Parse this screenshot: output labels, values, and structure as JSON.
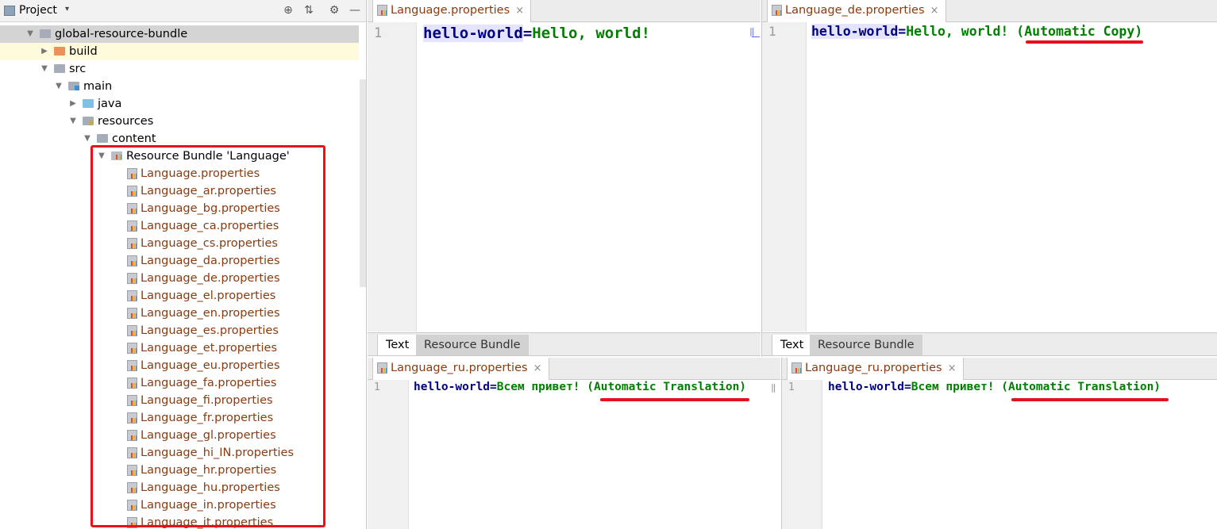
{
  "project_panel": {
    "title": "Project",
    "dropdown_glyph": "▾",
    "buttons": [
      "⊕",
      "⇅",
      "⚙",
      "—"
    ],
    "tree": [
      {
        "label": "global-resource-bundle",
        "icon": "folder-gray",
        "arrow": "▼"
      },
      {
        "label": "build",
        "icon": "folder-orange",
        "arrow": "▶"
      },
      {
        "label": "src",
        "icon": "folder-gray",
        "arrow": "▼"
      },
      {
        "label": "main",
        "icon": "folder-main",
        "arrow": "▼"
      },
      {
        "label": "java",
        "icon": "folder-blue",
        "arrow": "▶"
      },
      {
        "label": "resources",
        "icon": "folder-resources",
        "arrow": "▼"
      },
      {
        "label": "content",
        "icon": "folder-gray",
        "arrow": "▼"
      },
      {
        "label": "Resource Bundle 'Language'",
        "icon": "resource-bundle",
        "arrow": "▼"
      },
      {
        "label": "Language.properties",
        "icon": "properties-file"
      },
      {
        "label": "Language_ar.properties",
        "icon": "properties-file"
      },
      {
        "label": "Language_bg.properties",
        "icon": "properties-file"
      },
      {
        "label": "Language_ca.properties",
        "icon": "properties-file"
      },
      {
        "label": "Language_cs.properties",
        "icon": "properties-file"
      },
      {
        "label": "Language_da.properties",
        "icon": "properties-file"
      },
      {
        "label": "Language_de.properties",
        "icon": "properties-file"
      },
      {
        "label": "Language_el.properties",
        "icon": "properties-file"
      },
      {
        "label": "Language_en.properties",
        "icon": "properties-file"
      },
      {
        "label": "Language_es.properties",
        "icon": "properties-file"
      },
      {
        "label": "Language_et.properties",
        "icon": "properties-file"
      },
      {
        "label": "Language_eu.properties",
        "icon": "properties-file"
      },
      {
        "label": "Language_fa.properties",
        "icon": "properties-file"
      },
      {
        "label": "Language_fi.properties",
        "icon": "properties-file"
      },
      {
        "label": "Language_fr.properties",
        "icon": "properties-file"
      },
      {
        "label": "Language_gl.properties",
        "icon": "properties-file"
      },
      {
        "label": "Language_hi_IN.properties",
        "icon": "properties-file"
      },
      {
        "label": "Language_hr.properties",
        "icon": "properties-file"
      },
      {
        "label": "Language_hu.properties",
        "icon": "properties-file"
      },
      {
        "label": "Language_in.properties",
        "icon": "properties-file"
      },
      {
        "label": "Language_it.properties",
        "icon": "properties-file"
      }
    ]
  },
  "editors": {
    "top_left": {
      "tab": "Language.properties",
      "line": "1",
      "key": "hello-world",
      "eq": "=",
      "value": "Hello, world!",
      "marker": "‖"
    },
    "top_right": {
      "tab": "Language_de.properties",
      "line": "1",
      "key": "hello-world",
      "eq": "=",
      "value": "Hello, world! (Automatic Copy)"
    },
    "bottom_left": {
      "tab": "Language_ru.properties",
      "line": "1",
      "key": "hello-world",
      "eq": "=",
      "value": "Всем привет! (Automatic Translation)",
      "marker": "‖"
    },
    "bottom_right": {
      "tab": "Language_ru.properties",
      "line": "1",
      "key": "hello-world",
      "eq": "=",
      "value": "Всем привет! (Automatic Translation)"
    },
    "close_glyph": "×",
    "bottom_tabs": {
      "text": "Text",
      "resource_bundle": "Resource Bundle"
    }
  },
  "colors": {
    "annotation": "#e8101a",
    "key": "#000080",
    "value": "#008000",
    "file_label": "#8a3b0f"
  }
}
